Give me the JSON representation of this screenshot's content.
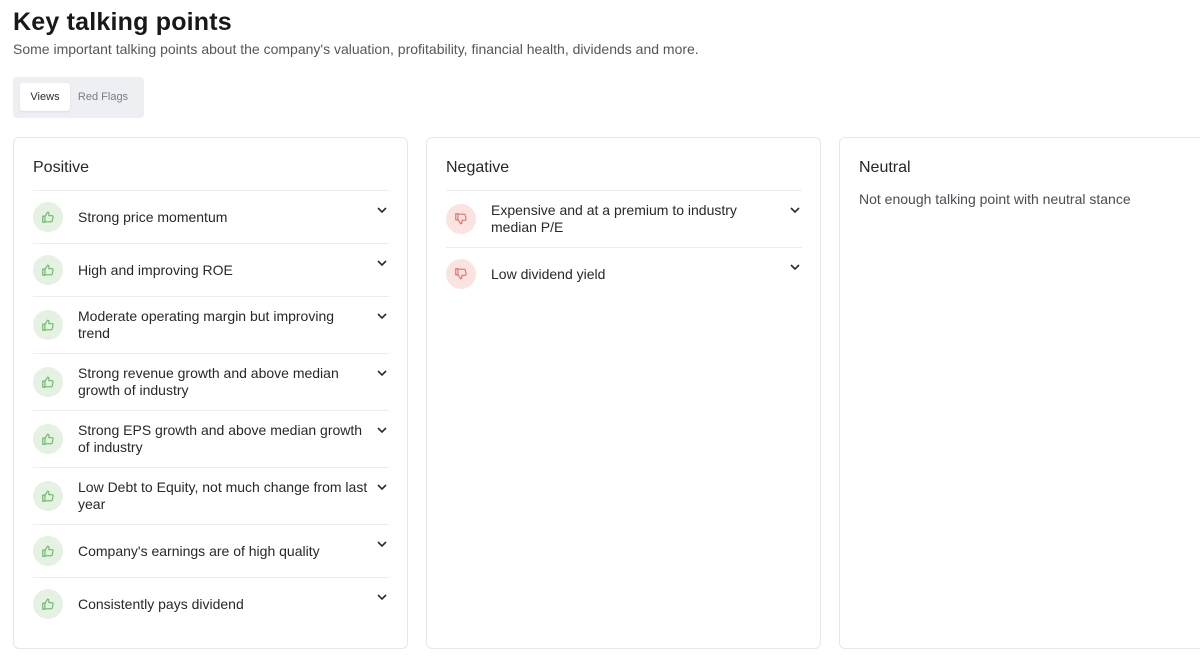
{
  "header": {
    "title": "Key talking points",
    "subtitle": "Some important talking points about the company's valuation, profitability, financial health, dividends and more."
  },
  "tabs": [
    {
      "label": "Views",
      "active": true
    },
    {
      "label": "Red Flags",
      "active": false
    }
  ],
  "colors": {
    "positive_icon_bg": "#e5f1e3",
    "positive_icon": "#6cb86a",
    "negative_icon_bg": "#fbe3e1",
    "negative_icon": "#e0726a"
  },
  "positive": {
    "title": "Positive",
    "items": [
      {
        "label": "Strong price momentum"
      },
      {
        "label": "High and improving ROE"
      },
      {
        "label": "Moderate operating margin but improving trend"
      },
      {
        "label": "Strong revenue growth and above median growth of industry"
      },
      {
        "label": "Strong EPS growth and above median growth of industry"
      },
      {
        "label": "Low Debt to Equity, not much change from last year"
      },
      {
        "label": "Company's earnings are of high quality"
      },
      {
        "label": "Consistently pays dividend"
      }
    ]
  },
  "negative": {
    "title": "Negative",
    "items": [
      {
        "label": "Expensive and at a premium to industry median P/E"
      },
      {
        "label": "Low dividend yield"
      }
    ]
  },
  "neutral": {
    "title": "Neutral",
    "empty_message": "Not enough talking point with neutral stance"
  }
}
